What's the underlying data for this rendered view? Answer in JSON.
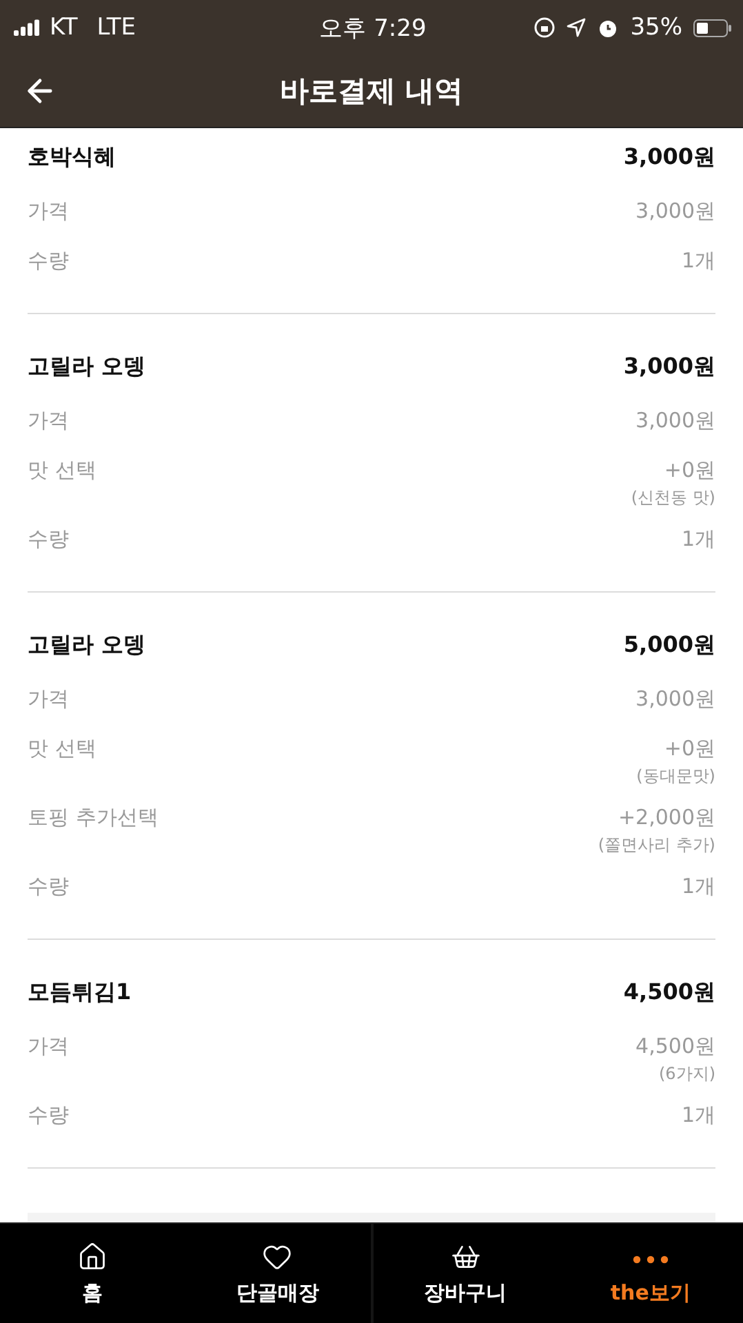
{
  "status_bar": {
    "carrier": "KT",
    "network": "LTE",
    "time": "오후 7:29",
    "battery": "35%"
  },
  "header": {
    "title": "바로결제 내역"
  },
  "items": [
    {
      "name": "호박식혜",
      "total": "3,000원",
      "rows": [
        {
          "label": "가격",
          "value": "3,000원"
        },
        {
          "label": "수량",
          "value": "1개"
        }
      ]
    },
    {
      "name": "고릴라 오뎅",
      "total": "3,000원",
      "rows": [
        {
          "label": "가격",
          "value": "3,000원"
        },
        {
          "label": "맛 선택",
          "value": "+0원",
          "note": "(신천동 맛)"
        },
        {
          "label": "수량",
          "value": "1개"
        }
      ]
    },
    {
      "name": "고릴라 오뎅",
      "total": "5,000원",
      "rows": [
        {
          "label": "가격",
          "value": "3,000원"
        },
        {
          "label": "맛 선택",
          "value": "+0원",
          "note": "(동대문맛)"
        },
        {
          "label": "토핑 추가선택",
          "value": "+2,000원",
          "note": "(쫄면사리 추가)"
        },
        {
          "label": "수량",
          "value": "1개"
        }
      ]
    },
    {
      "name": "모듬튀김1",
      "total": "4,500원",
      "rows": [
        {
          "label": "가격",
          "value": "4,500원",
          "note": "(6가지)"
        },
        {
          "label": "수량",
          "value": "1개"
        }
      ]
    }
  ],
  "tab_bar": [
    {
      "kind": "home",
      "label": "홈",
      "selected": false
    },
    {
      "kind": "heart",
      "label": "단골매장",
      "selected": false
    },
    {
      "kind": "basket",
      "label": "장바구니",
      "selected": false
    },
    {
      "kind": "more",
      "label": "the보기",
      "selected": true
    }
  ]
}
